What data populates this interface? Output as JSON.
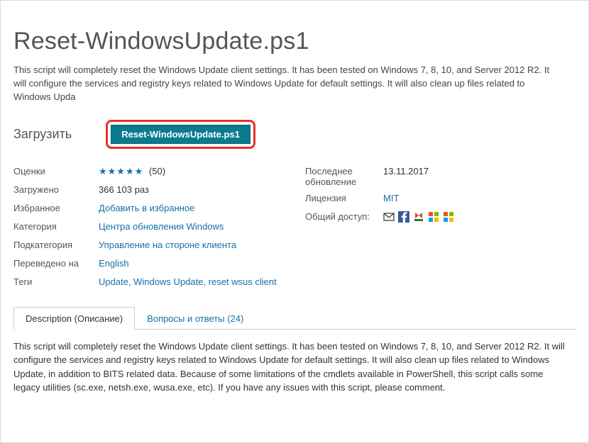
{
  "page": {
    "title": "Reset-WindowsUpdate.ps1",
    "summary": "This script will completely reset the Windows Update client settings. It has been tested on Windows 7, 8, 10, and Server 2012 R2. It will configure the services and registry keys related to Windows Update for default settings. It will also clean up files related to Windows Upda"
  },
  "download": {
    "label": "Загрузить",
    "button": "Reset-WindowsUpdate.ps1"
  },
  "meta_left": {
    "ratings_label": "Оценки",
    "ratings_stars": "★★★★★",
    "ratings_count": "(50)",
    "downloaded_label": "Загружено",
    "downloaded_value": "366 103 раз",
    "favorites_label": "Избранное",
    "favorites_link": "Добавить в избранное",
    "category_label": "Категория",
    "category_link": "Центра обновления Windows",
    "subcategory_label": "Подкатегория",
    "subcategory_link": "Управление на стороне клиента",
    "translated_label": "Переведено на",
    "translated_link": "English",
    "tags_label": "Теги",
    "tags_links": "Update, Windows Update, reset wsus client"
  },
  "meta_right": {
    "updated_label": "Последнее обновление",
    "updated_value": "13.11.2017",
    "license_label": "Лицензия",
    "license_link": "MIT",
    "share_label": "Общий доступ:"
  },
  "tabs": {
    "description": "Description (Описание)",
    "qa": "Вопросы и ответы (24)"
  },
  "description_body": "This script will completely reset the Windows Update client settings. It has been tested on Windows 7, 8, 10, and Server 2012 R2. It will configure the services and registry keys related to Windows Update for default settings. It will also clean up files related to Windows Update, in addition to BITS related data. Because of some limitations of the cmdlets available in PowerShell, this script calls some legacy utilities (sc.exe, netsh.exe, wusa.exe, etc). If you have any issues with this script, please comment."
}
